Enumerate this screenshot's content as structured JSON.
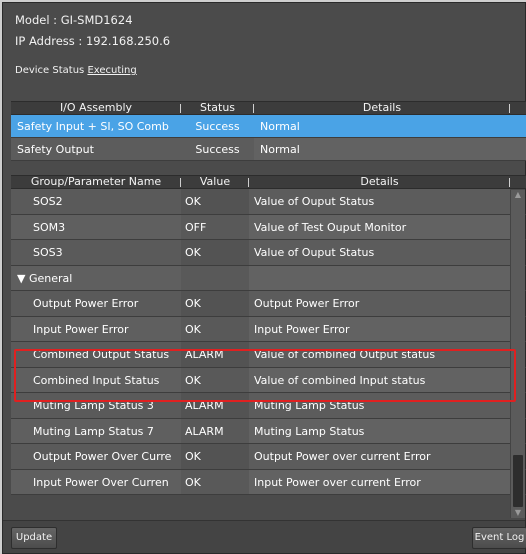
{
  "header": {
    "model_label": "Model : GI-SMD1624",
    "ip_label": "IP Address : 192.168.250.6",
    "device_status_label": "Device Status",
    "device_status_value": "Executing"
  },
  "assembly": {
    "columns": [
      "I/O Assembly",
      "Status",
      "Details"
    ],
    "rows": [
      {
        "name": "Safety Input + SI, SO Comb",
        "status": "Success",
        "details": "Normal"
      },
      {
        "name": "Safety Output",
        "status": "Success",
        "details": "Normal"
      }
    ]
  },
  "params": {
    "columns": [
      "Group/Parameter Name",
      "Value",
      "Details"
    ],
    "rows": [
      {
        "name": "SOS2",
        "value": "OK",
        "details": "Value of Ouput Status"
      },
      {
        "name": "SOM3",
        "value": "OFF",
        "details": "Value of Test Ouput Monitor"
      },
      {
        "name": "SOS3",
        "value": "OK",
        "details": "Value of Ouput Status"
      },
      {
        "name": "▼ General",
        "value": "",
        "details": ""
      },
      {
        "name": "Output Power Error",
        "value": "OK",
        "details": "Output Power Error"
      },
      {
        "name": "Input Power Error",
        "value": "OK",
        "details": "Input Power Error"
      },
      {
        "name": "Combined Output Status",
        "value": "ALARM",
        "details": "Value of combined Output status"
      },
      {
        "name": "Combined Input Status",
        "value": "OK",
        "details": "Value of combined Input status"
      },
      {
        "name": "Muting Lamp Status 3",
        "value": "ALARM",
        "details": "Muting Lamp Status"
      },
      {
        "name": "Muting Lamp Status 7",
        "value": "ALARM",
        "details": "Muting Lamp Status"
      },
      {
        "name": "Output Power Over Curre",
        "value": "OK",
        "details": "Output Power over current Error"
      },
      {
        "name": "Input Power Over Curren",
        "value": "OK",
        "details": "Input Power over current Error"
      }
    ]
  },
  "footer": {
    "update_label": "Update",
    "event_log_label": "Event Log"
  }
}
